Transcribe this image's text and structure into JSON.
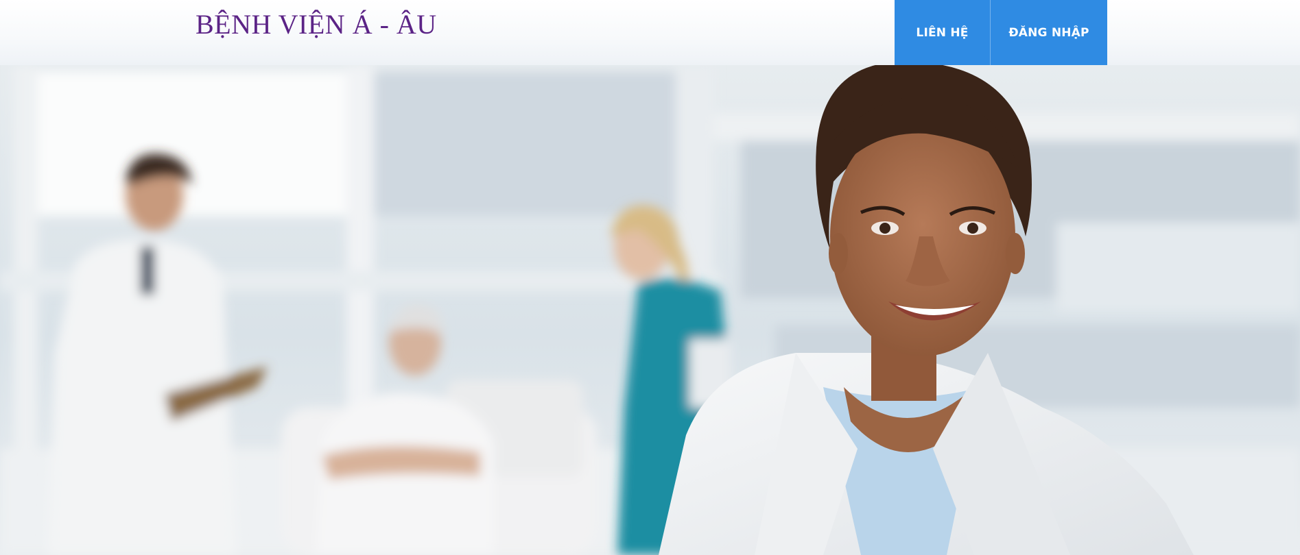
{
  "header": {
    "brand_title": "BỆNH VIỆN Á - ÂU",
    "nav": {
      "contact_label": "LIÊN HỆ",
      "login_label": "ĐĂNG NHẬP"
    }
  },
  "colors": {
    "brand_text": "#5b2386",
    "nav_background": "#2f8be3",
    "nav_text": "#ffffff"
  },
  "hero": {
    "image_subject": "smiling female doctor in white coat in hospital room with blurred doctor, nurse and patient"
  }
}
